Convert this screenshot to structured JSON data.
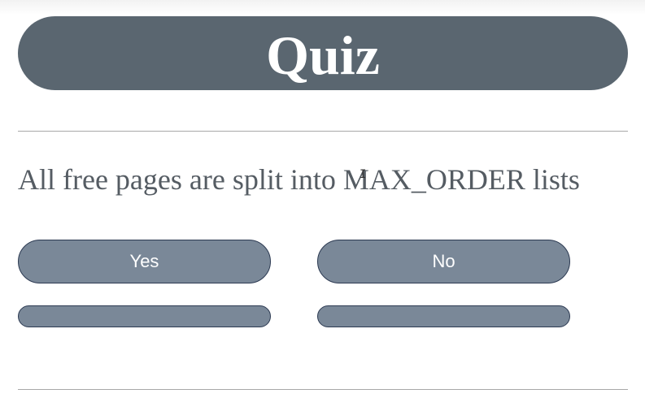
{
  "header": {
    "title": "Quiz"
  },
  "question": {
    "text": "All free pages are split into MAX_ORDER lists"
  },
  "answers": [
    {
      "label": "Yes"
    },
    {
      "label": "No"
    }
  ],
  "colors": {
    "header_bg": "#5a6670",
    "button_bg": "#7a8898",
    "button_border": "#2c3a52"
  }
}
